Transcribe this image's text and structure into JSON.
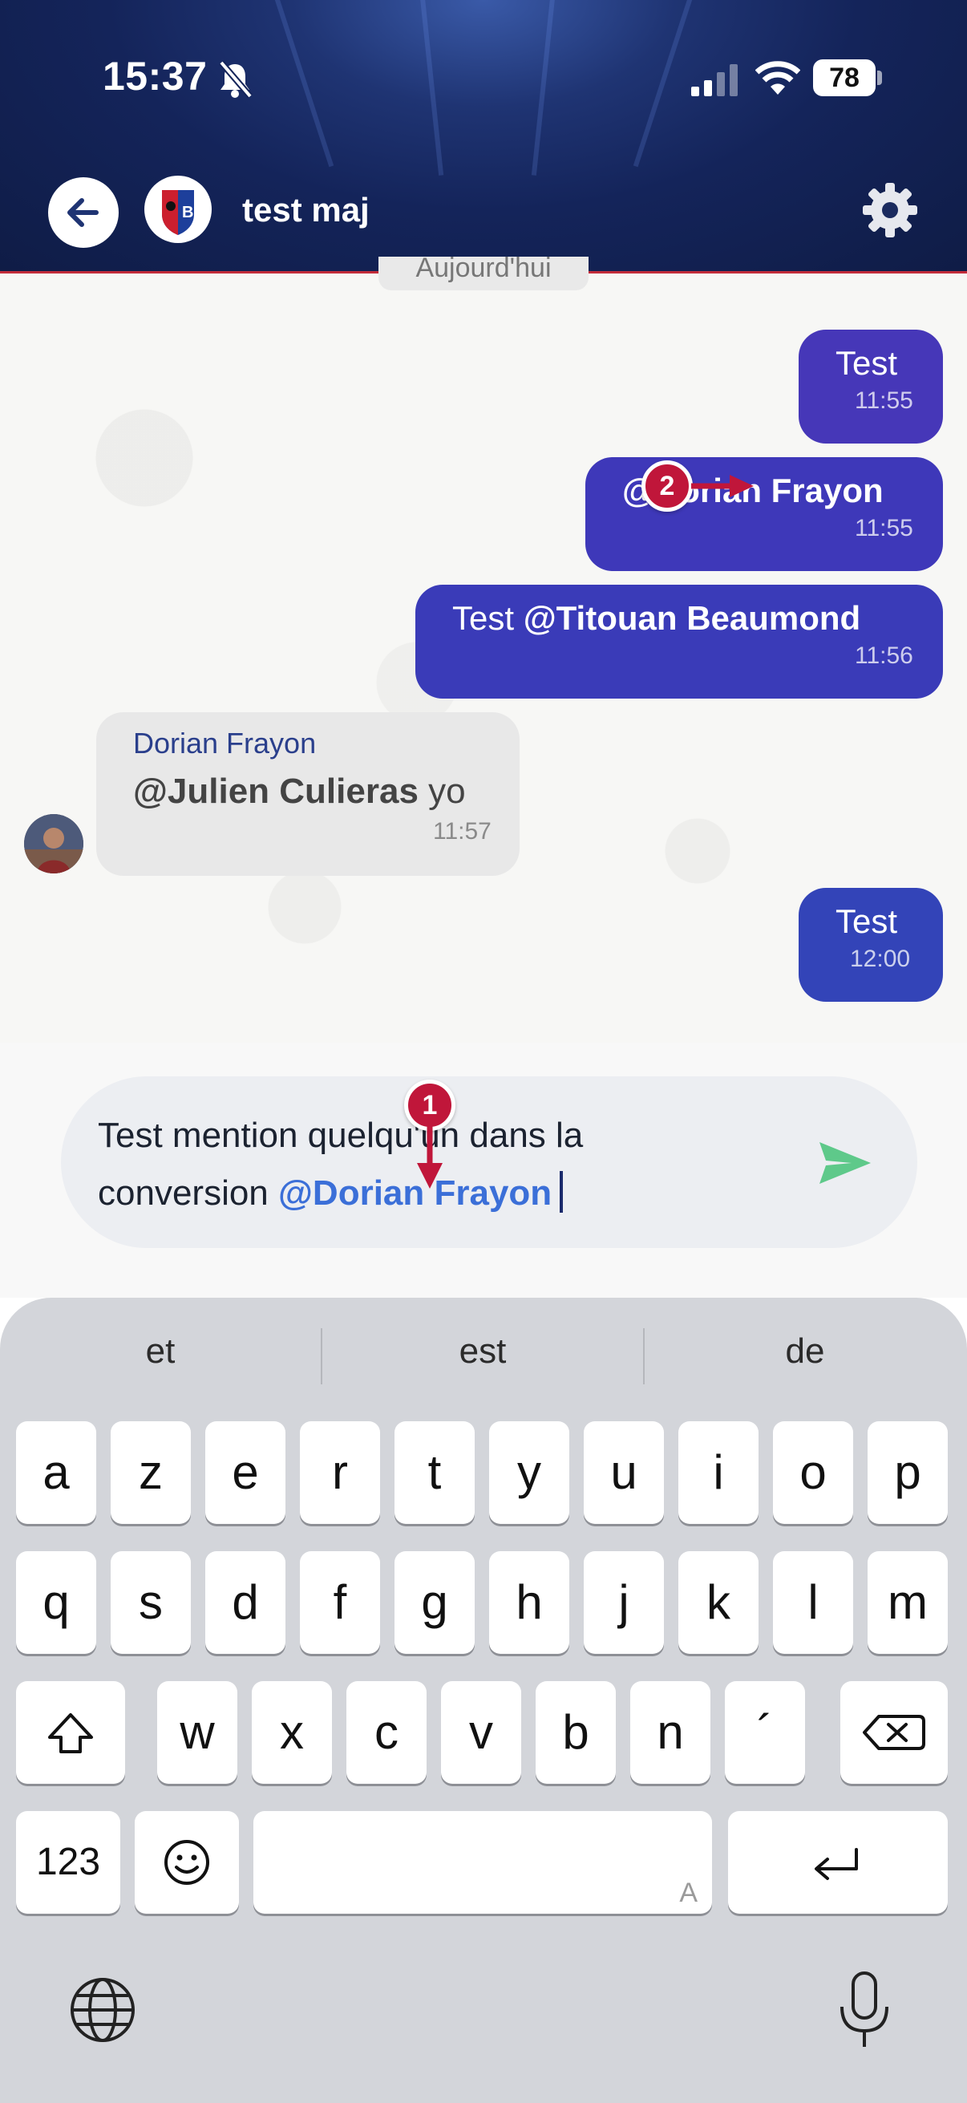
{
  "status_bar": {
    "time": "15:37",
    "battery": "78"
  },
  "header": {
    "title": "test maj",
    "team_badge": "B"
  },
  "chat": {
    "date_separator": "Aujourd'hui",
    "messages": [
      {
        "direction": "out",
        "text": "Test",
        "time": "11:55"
      },
      {
        "direction": "out",
        "mention": "@Dorian Frayon",
        "text": "",
        "time": "11:55"
      },
      {
        "direction": "out",
        "text": "Test ",
        "mention": "@Titouan Beaumond",
        "time": "11:56"
      },
      {
        "direction": "in",
        "sender": "Dorian Frayon",
        "mention": "@Julien Culieras",
        "text": " yo",
        "time": "11:57"
      },
      {
        "direction": "out",
        "text": "Test",
        "time": "12:00"
      }
    ]
  },
  "composer": {
    "text_line1": "Test mention quelqu'un dans la",
    "text_line2": "conversion ",
    "mention": "@Dorian Frayon"
  },
  "annotations": {
    "marker1": "1",
    "marker2": "2"
  },
  "keyboard": {
    "suggestions": [
      "et",
      "est",
      "de"
    ],
    "row1": [
      "a",
      "z",
      "e",
      "r",
      "t",
      "y",
      "u",
      "i",
      "o",
      "p"
    ],
    "row2": [
      "q",
      "s",
      "d",
      "f",
      "g",
      "h",
      "j",
      "k",
      "l",
      "m"
    ],
    "row3": [
      "w",
      "x",
      "c",
      "v",
      "b",
      "n",
      "´"
    ],
    "numbers_key": "123",
    "space_hint": "A"
  },
  "colors": {
    "header": "#14245a",
    "bubble_out": "#3b3db8",
    "mention_blue": "#3b6fd8",
    "send": "#5ec98a",
    "annotation": "#c0163a"
  }
}
